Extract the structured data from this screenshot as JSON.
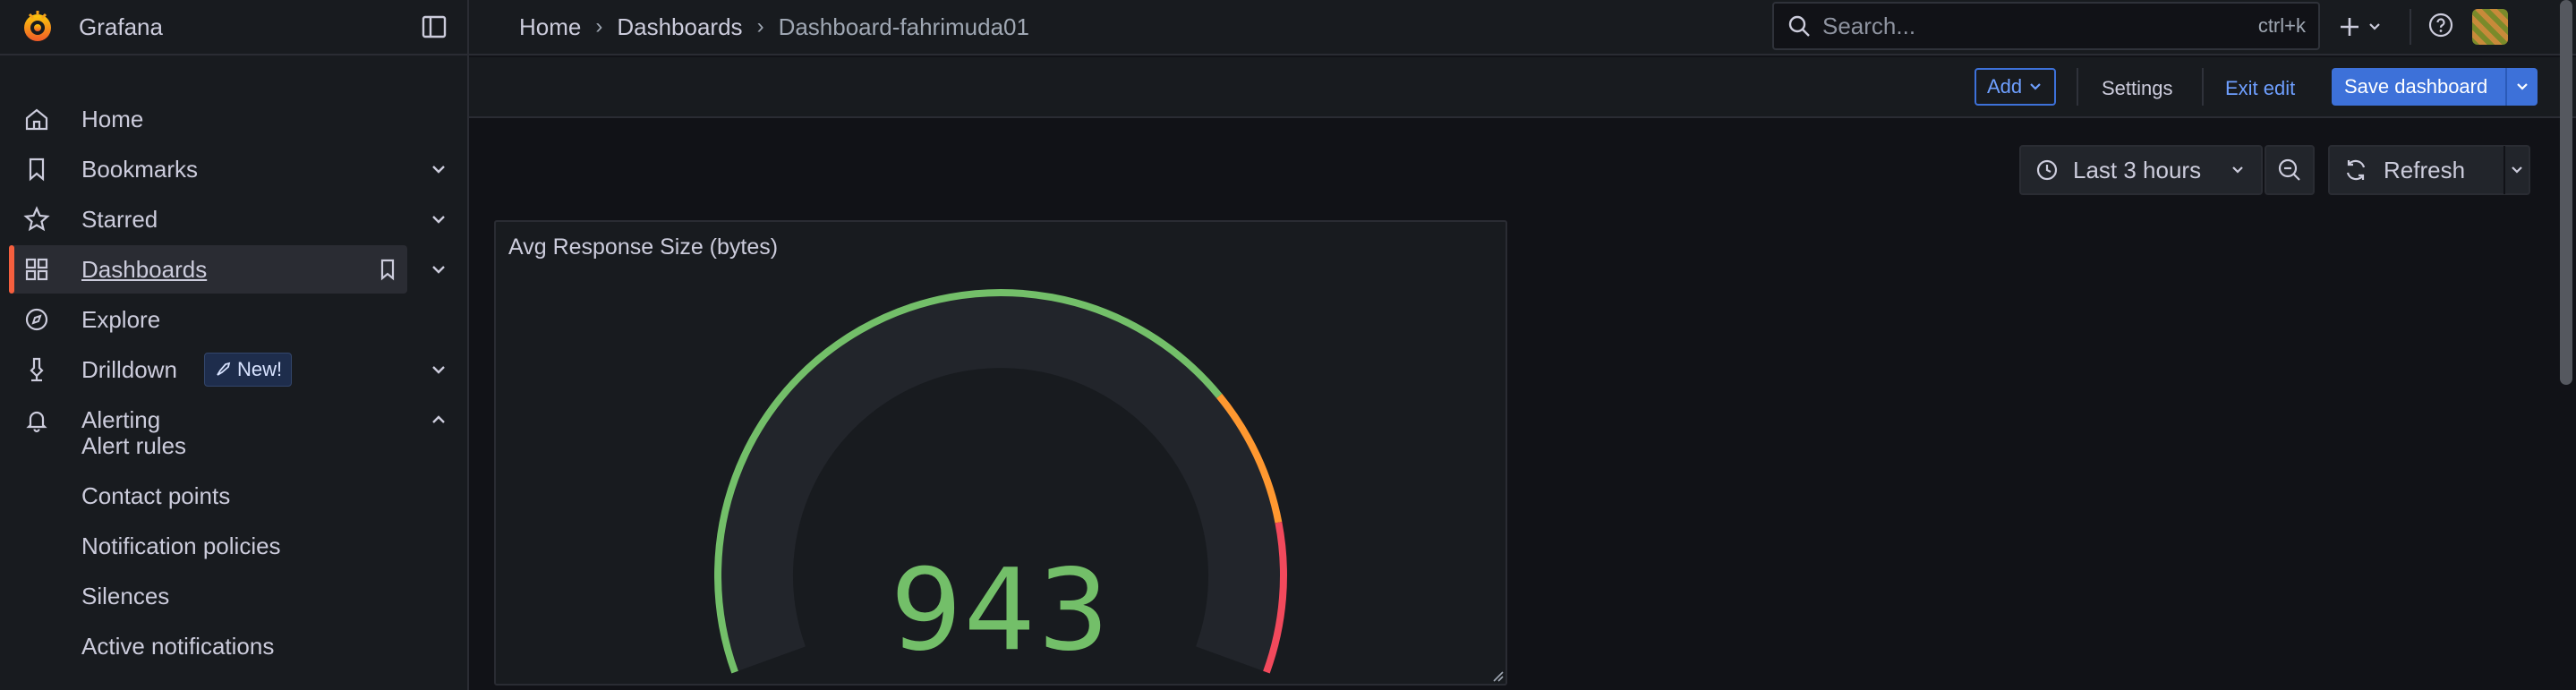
{
  "app": {
    "title": "Grafana"
  },
  "breadcrumb": {
    "home": "Home",
    "dashboards": "Dashboards",
    "current": "Dashboard-fahrimuda01"
  },
  "search": {
    "placeholder": "Search...",
    "shortcut": "ctrl+k"
  },
  "topbar": {
    "add_icon": "plus-icon",
    "help_icon": "help-icon"
  },
  "sidebar": {
    "items": [
      {
        "label": "Home",
        "icon": "home-icon"
      },
      {
        "label": "Bookmarks",
        "icon": "bookmark-icon"
      },
      {
        "label": "Starred",
        "icon": "star-icon"
      },
      {
        "label": "Dashboards",
        "icon": "apps-icon",
        "active": true
      },
      {
        "label": "Explore",
        "icon": "compass-icon"
      },
      {
        "label": "Drilldown",
        "icon": "drilldown-icon",
        "badge": "New!"
      },
      {
        "label": "Alerting",
        "icon": "bell-icon",
        "expanded": true
      }
    ],
    "alerting_children": [
      "Alert rules",
      "Contact points",
      "Notification policies",
      "Silences",
      "Active notifications"
    ]
  },
  "edit_toolbar": {
    "add": "Add",
    "settings": "Settings",
    "exit_edit": "Exit edit",
    "save": "Save dashboard"
  },
  "time_controls": {
    "range": "Last 3 hours",
    "refresh": "Refresh"
  },
  "panel": {
    "title": "Avg Response Size (bytes)",
    "value": "943",
    "gauge_fraction": 1.0,
    "colors": {
      "green": "#73bf69",
      "orange": "#ff9830",
      "red": "#f2495c",
      "track": "#22252b"
    }
  },
  "colors": {
    "accent": "#f55f3e",
    "primary": "#3d71d9",
    "link": "#6e9fff"
  }
}
